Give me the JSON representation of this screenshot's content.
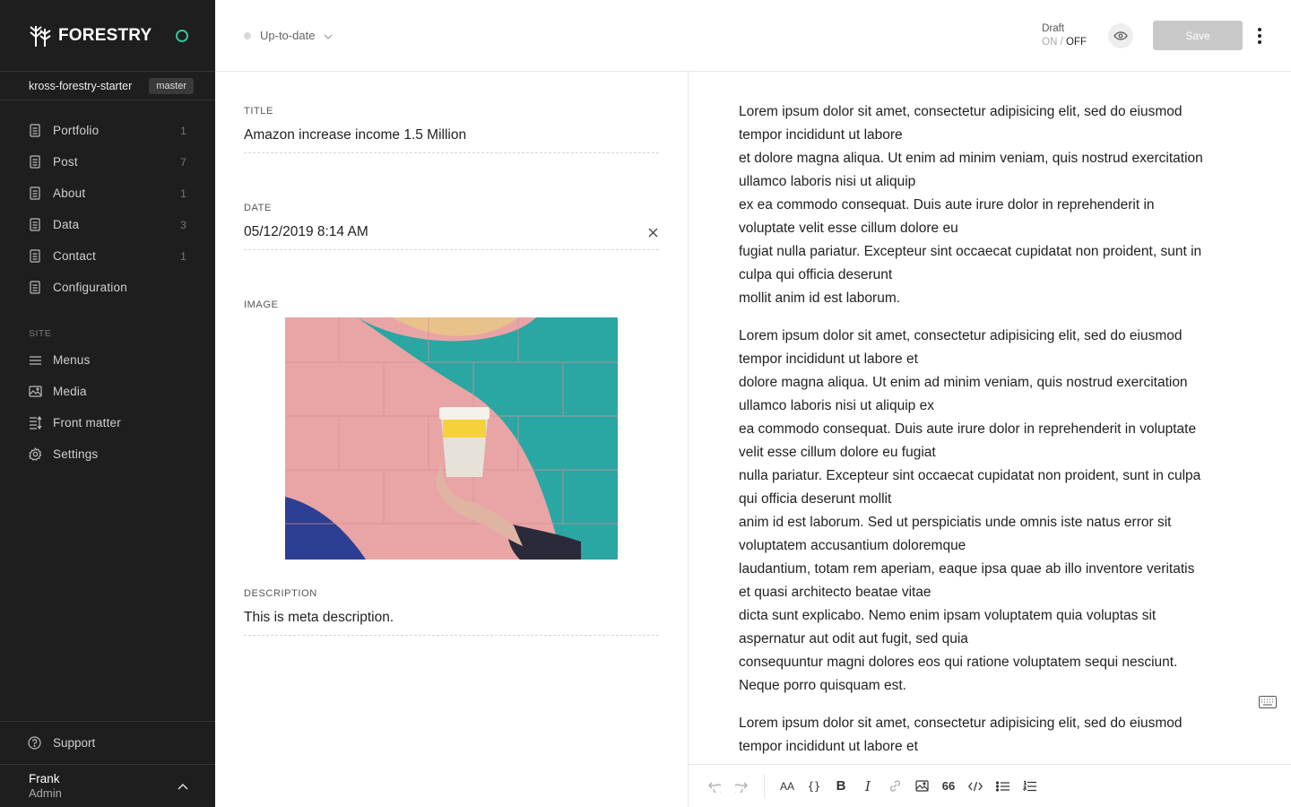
{
  "brand": {
    "name": "FORESTRY"
  },
  "repo": {
    "name": "kross-forestry-starter",
    "branch": "master"
  },
  "sidebar": {
    "content_items": [
      {
        "label": "Portfolio",
        "count": "1"
      },
      {
        "label": "Post",
        "count": "7"
      },
      {
        "label": "About",
        "count": "1"
      },
      {
        "label": "Data",
        "count": "3"
      },
      {
        "label": "Contact",
        "count": "1"
      },
      {
        "label": "Configuration",
        "count": ""
      }
    ],
    "site_label": "SITE",
    "site_items": [
      {
        "label": "Menus",
        "icon": "menu-icon"
      },
      {
        "label": "Media",
        "icon": "image-icon"
      },
      {
        "label": "Front matter",
        "icon": "front-matter-icon"
      },
      {
        "label": "Settings",
        "icon": "gear-icon"
      }
    ],
    "support_label": "Support",
    "user": {
      "name": "Frank",
      "role": "Admin"
    }
  },
  "topbar": {
    "sync_status": "Up-to-date",
    "draft_label": "Draft",
    "draft_on": "ON",
    "draft_sep": " / ",
    "draft_off": "OFF",
    "save_label": "Save"
  },
  "fields": {
    "title": {
      "label": "TITLE",
      "value": "Amazon increase income 1.5 Million"
    },
    "date": {
      "label": "DATE",
      "value": "05/12/2019 8:14 AM"
    },
    "image": {
      "label": "IMAGE"
    },
    "description": {
      "label": "DESCRIPTION",
      "value": "This is meta description."
    }
  },
  "editor": {
    "paragraphs": [
      "Lorem ipsum dolor sit amet, consectetur adipisicing elit, sed do eiusmod\ntempor incididunt ut labore\net dolore magna aliqua. Ut enim ad minim veniam, quis nostrud exercitation\nullamco laboris nisi ut aliquip\nex ea commodo consequat. Duis aute irure dolor in reprehenderit in\nvoluptate velit esse cillum dolore eu\nfugiat nulla pariatur. Excepteur sint occaecat cupidatat non proident, sunt in\nculpa qui officia deserunt\nmollit anim id est laborum.",
      "Lorem ipsum dolor sit amet, consectetur adipisicing elit, sed do eiusmod\ntempor incididunt ut labore et\ndolore magna aliqua. Ut enim ad minim veniam, quis nostrud exercitation\nullamco laboris nisi ut aliquip ex\nea commodo consequat. Duis aute irure dolor in reprehenderit in voluptate\nvelit esse cillum dolore eu fugiat\nnulla pariatur. Excepteur sint occaecat cupidatat non proident, sunt in culpa\nqui officia deserunt mollit\nanim id est laborum. Sed ut perspiciatis unde omnis iste natus error sit\nvoluptatem accusantium doloremque\nlaudantium, totam rem aperiam, eaque ipsa quae ab illo inventore veritatis\net quasi architecto beatae vitae\ndicta sunt explicabo. Nemo enim ipsam voluptatem quia voluptas sit\naspernatur aut odit aut fugit, sed quia\nconsequuntur magni dolores eos qui ratione voluptatem sequi nesciunt.\nNeque porro quisquam est.",
      "Lorem ipsum dolor sit amet, consectetur adipisicing elit, sed do eiusmod\ntempor incididunt ut labore et"
    ]
  },
  "toolbar": {
    "buttons": [
      "undo-icon",
      "redo-icon",
      "font-size-icon",
      "code-braces-icon",
      "bold-icon",
      "italic-icon",
      "link-icon",
      "image-icon",
      "quote-icon",
      "code-icon",
      "bullet-list-icon",
      "numbered-list-icon"
    ],
    "format_glyphs": {
      "font": "AA",
      "braces": "{}",
      "bold": "B",
      "italic": "I",
      "quote": "66"
    }
  },
  "colors": {
    "sidebar_bg": "#1e1e1e",
    "status_green": "#2ec69a",
    "save_disabled": "#c8c8c8"
  }
}
